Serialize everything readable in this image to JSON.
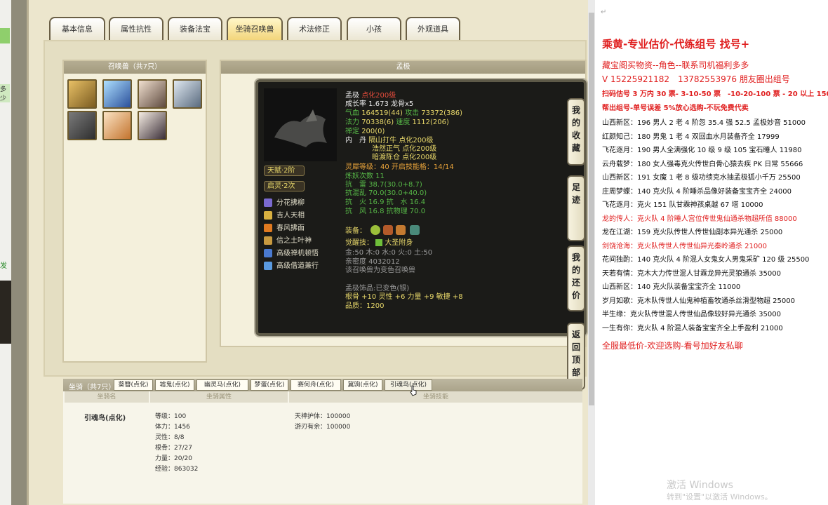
{
  "left_strip": {
    "text1": "多少",
    "text2": "发"
  },
  "tabs": [
    "基本信息",
    "属性抗性",
    "装备法宝",
    "坐骑召唤兽",
    "术法修正",
    "小孩",
    "外观道具"
  ],
  "active_tab": "坐骑召唤兽",
  "summons": {
    "header": "召唤兽（共7只）",
    "count": 7
  },
  "detail": {
    "header": "孟极",
    "name": "孟极",
    "tag": "点化200级",
    "growth": "成长率 1.673 龙骨x5",
    "hp_label": "气血",
    "hp": "164519(44)",
    "atk_label": "攻击",
    "atk": "73372(386)",
    "mp_label": "法力",
    "mp": "70338(6)",
    "spd_label": "速度",
    "spd": "1112(206)",
    "chan_label": "禅定",
    "chan": "200(0)",
    "dan_prefix": "内　丹",
    "dan1": "隔山打牛 点化200级",
    "dan2": "浩然正气 点化200级",
    "dan3": "暗渡陈仓 点化200级",
    "lingxi": "灵犀等级：40 开启技能格：14/14",
    "lianyao": "炼妖次数 11",
    "res1": "抗　雷 38.7(30.0+8.7)",
    "res2": "抗混乱 70.0(30.0+40.0)",
    "res3": "抗　火 16.9 抗　水 16.4",
    "res4": "抗　风 16.8 抗物理 70.0",
    "equip_label": "装备：",
    "awaken_label": "觉醒技：",
    "awaken": "大圣附身",
    "five_elements": "金:50 木:0 水:0 火:0 土:50",
    "intimacy": "亲密度 4032012",
    "note": "该召唤兽为变色召唤兽",
    "ornament": "孟极饰品:已变色(银)",
    "ornament_stats": "根骨 +10 灵性 +6 力量 +9 敏捷 +8",
    "quality": "品质：1200",
    "pill1": "天赋·2阶",
    "pill2": "启灵·2次",
    "skills": [
      "分花拂柳",
      "吉人天相",
      "春风拂面",
      "信之土叶神",
      "高级禅机顿悟",
      "高级借道兼行"
    ]
  },
  "side_buttons": [
    "我的收藏",
    "足迹",
    "我的还价",
    "返回顶部"
  ],
  "mounts": {
    "header": "坐骑（共7只）",
    "tabs": [
      "葵簪(点化)",
      "墟鬼(点化)",
      "幽灵马(点化)",
      "梦蛋(点化)",
      "赛何舟(点化)",
      "冀驹(点化)",
      "引魂鸟(点化)"
    ],
    "col_name": "坐骑名",
    "col_attr": "坐骑属性",
    "col_skill": "坐骑技能",
    "name": "引魂鸟(点化)",
    "attrs": [
      "等级：100",
      "体力：1456",
      "灵性：8/8",
      "根骨：27/27",
      "力量：20/20",
      "经验：863032"
    ],
    "skill1": "天神护体：100000",
    "skill2": "游刃有余：100000"
  },
  "right": {
    "title": "乘黄-专业估价-代练组号 找号+",
    "line2": "藏宝阁买物资--角色--联系司机福利多多",
    "line3": "V 15225921182　13782553976 朋友圈出组号",
    "line4": "扫码估号 3 万内 30 票- 3-10-50 票　-10-20-100 票 - 20 以上 150",
    "line5": "帮出组号-单号误差 5%放心选购-不玩免费代卖",
    "listings": [
      {
        "text": "山西新区：196 男人 2 老 4 阶忽 35.4 强 52.5 孟极妙音 51000",
        "red": false
      },
      {
        "text": "红颜知己：180 男鬼 1 老 4 双回血水月装备齐全 17999",
        "red": false
      },
      {
        "text": "飞花逐月：190 男人全满强化 10 级 9 级 105 宝石睡人 11980",
        "red": false
      },
      {
        "text": "云舟载梦：180 女人强毒克火传世白骨心猿去疾 PK 日常 55666",
        "red": false
      },
      {
        "text": "山西新区：191 女魔 1 老 8 级功绩克水抽孟极狐小千万 25500",
        "red": false
      },
      {
        "text": "庄周梦蝶：140 克火队 4 阶睡杀品像好装备宝宝齐全 24000",
        "red": false
      },
      {
        "text": "飞花逐月：克火 151 队甘霖神孩桌越 67 塔 10000",
        "red": false
      },
      {
        "text": "龙的传人：克火队 4 阶睡人宫位传世鬼仙通杀物超所值 88000",
        "red": true
      },
      {
        "text": "龙在江湖：159 克火队传世人传世仙副本异光通杀 25000",
        "red": false
      },
      {
        "text": "剑饶沧海：克火队传世人传世仙异光秦岭通杀 21000",
        "red": true
      },
      {
        "text": "花间独酌：140 克火队 4 阶混人女鬼女人男鬼采矿 120 级 25500",
        "red": false
      },
      {
        "text": "天若有情：克木大力传世混人甘霖龙异光灵狼通杀 35000",
        "red": false
      },
      {
        "text": "山西新区：140 克火队装备宝宝齐全 11000",
        "red": false
      },
      {
        "text": "岁月如歌：克木队传世人仙鬼种植畜牧通杀丝滑型物超 25000",
        "red": false
      },
      {
        "text": "半生缘：克火队传世混人传世仙品像较好异光通杀 35000",
        "red": false
      },
      {
        "text": "一生有你：克火队 4 阶混人装备宝宝齐全上手盈利 21000",
        "red": false
      }
    ],
    "footer": "全服最低价-欢迎选购-看号加好友私聊",
    "para_mark": "↵",
    "watermark1": "激活 Windows",
    "watermark2": "转到\"设置\"以激活 Windows。"
  },
  "colors": {
    "red": "#e01f1f",
    "gold": "#e8d86a",
    "green": "#57b847",
    "panel": "#ece6cd"
  }
}
